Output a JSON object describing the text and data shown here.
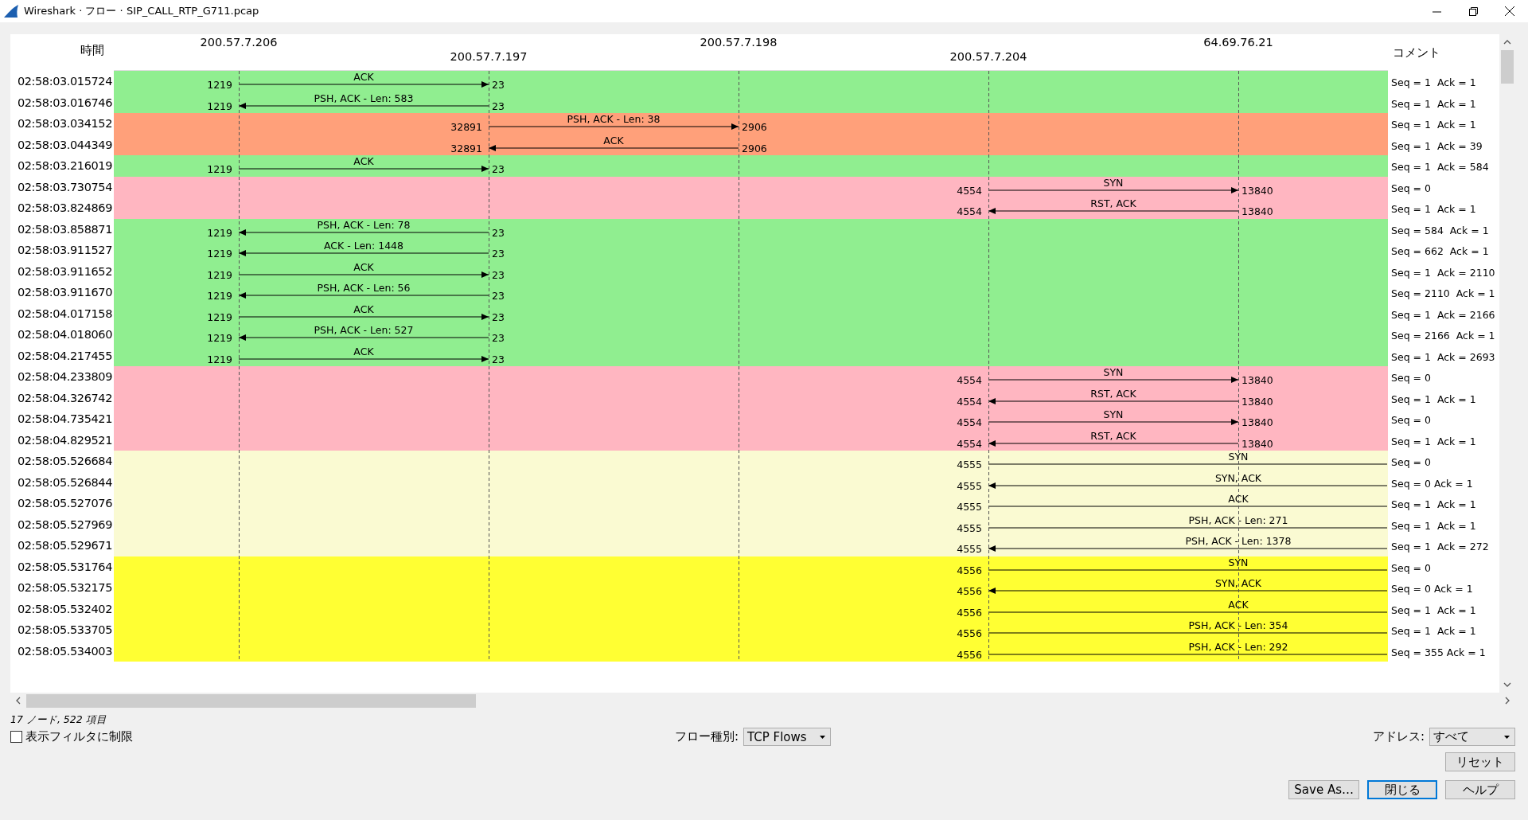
{
  "window": {
    "title": "Wireshark · フロー · SIP_CALL_RTP_G711.pcap"
  },
  "header": {
    "time": "時間",
    "comment": "コメント"
  },
  "nodes": [
    {
      "address": "200.57.7.206"
    },
    {
      "address": "200.57.7.197"
    },
    {
      "address": "200.57.7.198"
    },
    {
      "address": "200.57.7.204"
    },
    {
      "address": "64.69.76.21"
    }
  ],
  "bands": [
    {
      "color": "#90ee90",
      "kind": "pair-a",
      "rows": [
        {
          "time": "02:58:03.015724",
          "reversed": false,
          "left_port": "1219",
          "right_port": "23",
          "label": "ACK",
          "comment": "Seq = 1  Ack = 1"
        },
        {
          "time": "02:58:03.016746",
          "reversed": true,
          "left_port": "1219",
          "right_port": "23",
          "label": "PSH, ACK - Len: 583",
          "comment": "Seq = 1  Ack = 1"
        }
      ]
    },
    {
      "color": "#ffa07a",
      "kind": "pair-b",
      "rows": [
        {
          "time": "02:58:03.034152",
          "reversed": false,
          "left_port": "32891",
          "right_port": "2906",
          "label": "PSH, ACK - Len: 38",
          "comment": "Seq = 1  Ack = 1"
        },
        {
          "time": "02:58:03.044349",
          "reversed": true,
          "left_port": "32891",
          "right_port": "2906",
          "label": "ACK",
          "comment": "Seq = 1  Ack = 39"
        }
      ]
    },
    {
      "color": "#90ee90",
      "kind": "pair-a",
      "rows": [
        {
          "time": "02:58:03.216019",
          "reversed": false,
          "left_port": "1219",
          "right_port": "23",
          "label": "ACK",
          "comment": "Seq = 1  Ack = 584"
        }
      ]
    },
    {
      "color": "#ffb6c1",
      "kind": "pair-d",
      "rows": [
        {
          "time": "02:58:03.730754",
          "reversed": false,
          "left_port": "4554",
          "right_port": "13840",
          "label": "SYN",
          "comment": "Seq = 0"
        },
        {
          "time": "02:58:03.824869",
          "reversed": true,
          "left_port": "4554",
          "right_port": "13840",
          "label": "RST, ACK",
          "comment": "Seq = 1  Ack = 1"
        }
      ]
    },
    {
      "color": "#90ee90",
      "kind": "pair-a",
      "rows": [
        {
          "time": "02:58:03.858871",
          "reversed": true,
          "left_port": "1219",
          "right_port": "23",
          "label": "PSH, ACK - Len: 78",
          "comment": "Seq = 584  Ack = 1"
        },
        {
          "time": "02:58:03.911527",
          "reversed": true,
          "left_port": "1219",
          "right_port": "23",
          "label": "ACK - Len: 1448",
          "comment": "Seq = 662  Ack = 1"
        },
        {
          "time": "02:58:03.911652",
          "reversed": false,
          "left_port": "1219",
          "right_port": "23",
          "label": "ACK",
          "comment": "Seq = 1  Ack = 2110"
        },
        {
          "time": "02:58:03.911670",
          "reversed": true,
          "left_port": "1219",
          "right_port": "23",
          "label": "PSH, ACK - Len: 56",
          "comment": "Seq = 2110  Ack = 1"
        },
        {
          "time": "02:58:04.017158",
          "reversed": false,
          "left_port": "1219",
          "right_port": "23",
          "label": "ACK",
          "comment": "Seq = 1  Ack = 2166"
        },
        {
          "time": "02:58:04.018060",
          "reversed": true,
          "left_port": "1219",
          "right_port": "23",
          "label": "PSH, ACK - Len: 527",
          "comment": "Seq = 2166  Ack = 1"
        },
        {
          "time": "02:58:04.217455",
          "reversed": false,
          "left_port": "1219",
          "right_port": "23",
          "label": "ACK",
          "comment": "Seq = 1  Ack = 2693"
        }
      ]
    },
    {
      "color": "#ffb6c1",
      "kind": "pair-d",
      "rows": [
        {
          "time": "02:58:04.233809",
          "reversed": false,
          "left_port": "4554",
          "right_port": "13840",
          "label": "SYN",
          "comment": "Seq = 0"
        },
        {
          "time": "02:58:04.326742",
          "reversed": true,
          "left_port": "4554",
          "right_port": "13840",
          "label": "RST, ACK",
          "comment": "Seq = 1  Ack = 1"
        },
        {
          "time": "02:58:04.735421",
          "reversed": false,
          "left_port": "4554",
          "right_port": "13840",
          "label": "SYN",
          "comment": "Seq = 0"
        },
        {
          "time": "02:58:04.829521",
          "reversed": true,
          "left_port": "4554",
          "right_port": "13840",
          "label": "RST, ACK",
          "comment": "Seq = 1  Ack = 1"
        }
      ]
    },
    {
      "color": "#fafad2",
      "kind": "pair-offscreen",
      "rows": [
        {
          "time": "02:58:05.526684",
          "reversed": false,
          "left_port": "4555",
          "label": "SYN",
          "comment": "Seq = 0"
        },
        {
          "time": "02:58:05.526844",
          "reversed": true,
          "left_port": "4555",
          "label": "SYN, ACK",
          "comment": "Seq = 0 Ack = 1"
        },
        {
          "time": "02:58:05.527076",
          "reversed": false,
          "left_port": "4555",
          "label": "ACK",
          "comment": "Seq = 1  Ack = 1"
        },
        {
          "time": "02:58:05.527969",
          "reversed": false,
          "left_port": "4555",
          "label": "PSH, ACK - Len: 271",
          "comment": "Seq = 1  Ack = 1"
        },
        {
          "time": "02:58:05.529671",
          "reversed": true,
          "left_port": "4555",
          "label": "PSH, ACK - Len: 1378",
          "comment": "Seq = 1  Ack = 272"
        }
      ]
    },
    {
      "color": "#ffff33",
      "kind": "pair-offscreen",
      "rows": [
        {
          "time": "02:58:05.531764",
          "reversed": false,
          "left_port": "4556",
          "label": "SYN",
          "comment": "Seq = 0"
        },
        {
          "time": "02:58:05.532175",
          "reversed": true,
          "left_port": "4556",
          "label": "SYN, ACK",
          "comment": "Seq = 0 Ack = 1"
        },
        {
          "time": "02:58:05.532402",
          "reversed": false,
          "left_port": "4556",
          "label": "ACK",
          "comment": "Seq = 1  Ack = 1"
        },
        {
          "time": "02:58:05.533705",
          "reversed": false,
          "left_port": "4556",
          "label": "PSH, ACK - Len: 354",
          "comment": "Seq = 1  Ack = 1"
        },
        {
          "time": "02:58:05.534003",
          "reversed": false,
          "left_port": "4556",
          "label": "PSH, ACK - Len: 292",
          "comment": "Seq = 355 Ack = 1"
        }
      ]
    }
  ],
  "status": "17 ノード, 522 項目",
  "limit_filter": {
    "label": "表示フィルタに制限",
    "checked": false
  },
  "flow_type": {
    "label": "フロー種別:",
    "value": "TCP Flows"
  },
  "address": {
    "label": "アドレス:",
    "value": "すべて"
  },
  "buttons": [
    {
      "label": "リセット",
      "kind": "reset"
    },
    {
      "label": "Save As…",
      "kind": "normal"
    },
    {
      "label": "閉じる",
      "kind": "default"
    },
    {
      "label": "ヘルプ",
      "kind": "normal"
    }
  ]
}
